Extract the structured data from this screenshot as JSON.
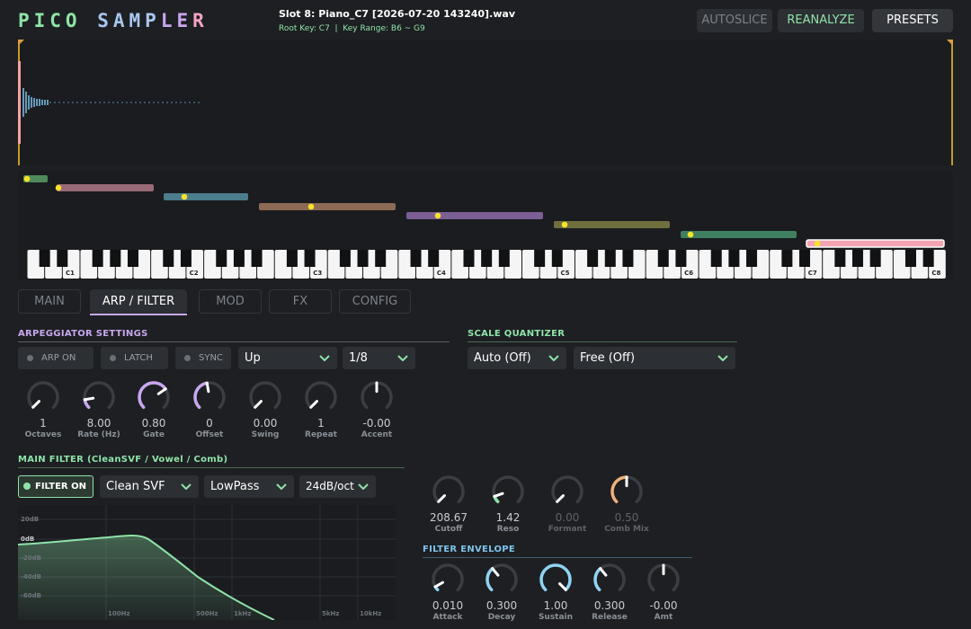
{
  "logo": {
    "p1": "PICO",
    "p2": "SAMP",
    "p3": "LE",
    "p4": "R"
  },
  "header": {
    "slot_name": "Slot 8: Piano_C7 [2026-07-20 143240].wav",
    "slot_info": "Root Key: C7  |  Key Range: B6 ~ G9",
    "autoslice": "AUTOSLICE",
    "reanalyze": "REANALYZE",
    "presets": "PRESETS"
  },
  "keyboard": {
    "octave_labels": [
      "C1",
      "C2",
      "C3",
      "C4",
      "C5",
      "C6",
      "C7",
      "C8"
    ],
    "zone_colors": [
      "#4f8a5a",
      "#9a6a78",
      "#4c7d8c",
      "#8d6a55",
      "#7b5f95",
      "#6f6f3e",
      "#3f8060",
      "#f4a3b3"
    ]
  },
  "tabs": [
    "MAIN",
    "ARP / FILTER",
    "MOD",
    "FX",
    "CONFIG"
  ],
  "arp": {
    "title": "ARPEGGIATOR SETTINGS",
    "arp_on": "ARP ON",
    "latch": "LATCH",
    "sync": "SYNC",
    "mode": "Up",
    "rate_div": "1/8",
    "knobs": [
      {
        "value": "1",
        "label": "Octaves"
      },
      {
        "value": "8.00",
        "label": "Rate (Hz)"
      },
      {
        "value": "0.80",
        "label": "Gate"
      },
      {
        "value": "0",
        "label": "Offset"
      },
      {
        "value": "0.00",
        "label": "Swing"
      },
      {
        "value": "1",
        "label": "Repeat"
      },
      {
        "value": "-0.00",
        "label": "Accent"
      }
    ]
  },
  "scale": {
    "title": "SCALE QUANTIZER",
    "root": "Auto (Off)",
    "scale": "Free (Off)"
  },
  "filter": {
    "title": "MAIN FILTER (CleanSVF / Vowel / Comb)",
    "on_label": "FILTER ON",
    "type": "Clean SVF",
    "mode": "LowPass",
    "slope": "24dB/oct",
    "graph": {
      "y_labels": [
        "20dB",
        "0dB",
        "-20dB",
        "-40dB",
        "-60dB"
      ],
      "x_labels": [
        "100Hz",
        "500Hz",
        "1kHz",
        "5kHz",
        "10kHz"
      ]
    },
    "knobs": [
      {
        "value": "208.67",
        "label": "Cutoff"
      },
      {
        "value": "1.42",
        "label": "Reso"
      },
      {
        "value": "0.00",
        "label": "Formant"
      },
      {
        "value": "0.50",
        "label": "Comb Mix"
      }
    ]
  },
  "env": {
    "title": "FILTER ENVELOPE",
    "knobs": [
      {
        "value": "0.010",
        "label": "Attack"
      },
      {
        "value": "0.300",
        "label": "Decay"
      },
      {
        "value": "1.00",
        "label": "Sustain"
      },
      {
        "value": "0.300",
        "label": "Release"
      },
      {
        "value": "-0.00",
        "label": "Amt"
      }
    ]
  }
}
